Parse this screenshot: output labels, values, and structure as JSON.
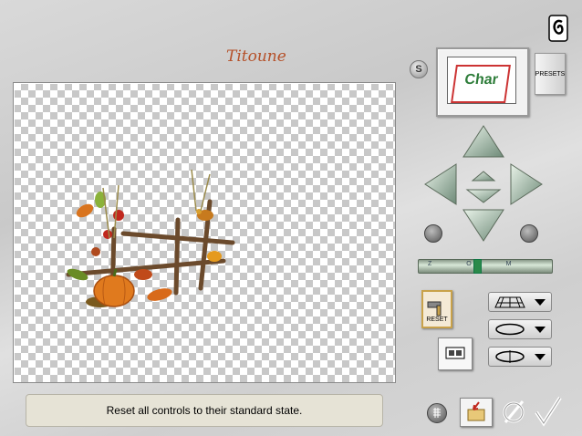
{
  "brand": {
    "name": "Titoune"
  },
  "status": {
    "text": "Reset all controls to their standard state."
  },
  "buttons": {
    "s_label": "S",
    "presets_label": "PRESETS",
    "reset_label": "RESET"
  },
  "thumbnail": {
    "text": "Char"
  },
  "slider": {
    "marks": "Z O M"
  },
  "colors": {
    "brand": "#b5512a",
    "status_bg": "#e6e3d6",
    "accent": "#2a8a4a"
  }
}
